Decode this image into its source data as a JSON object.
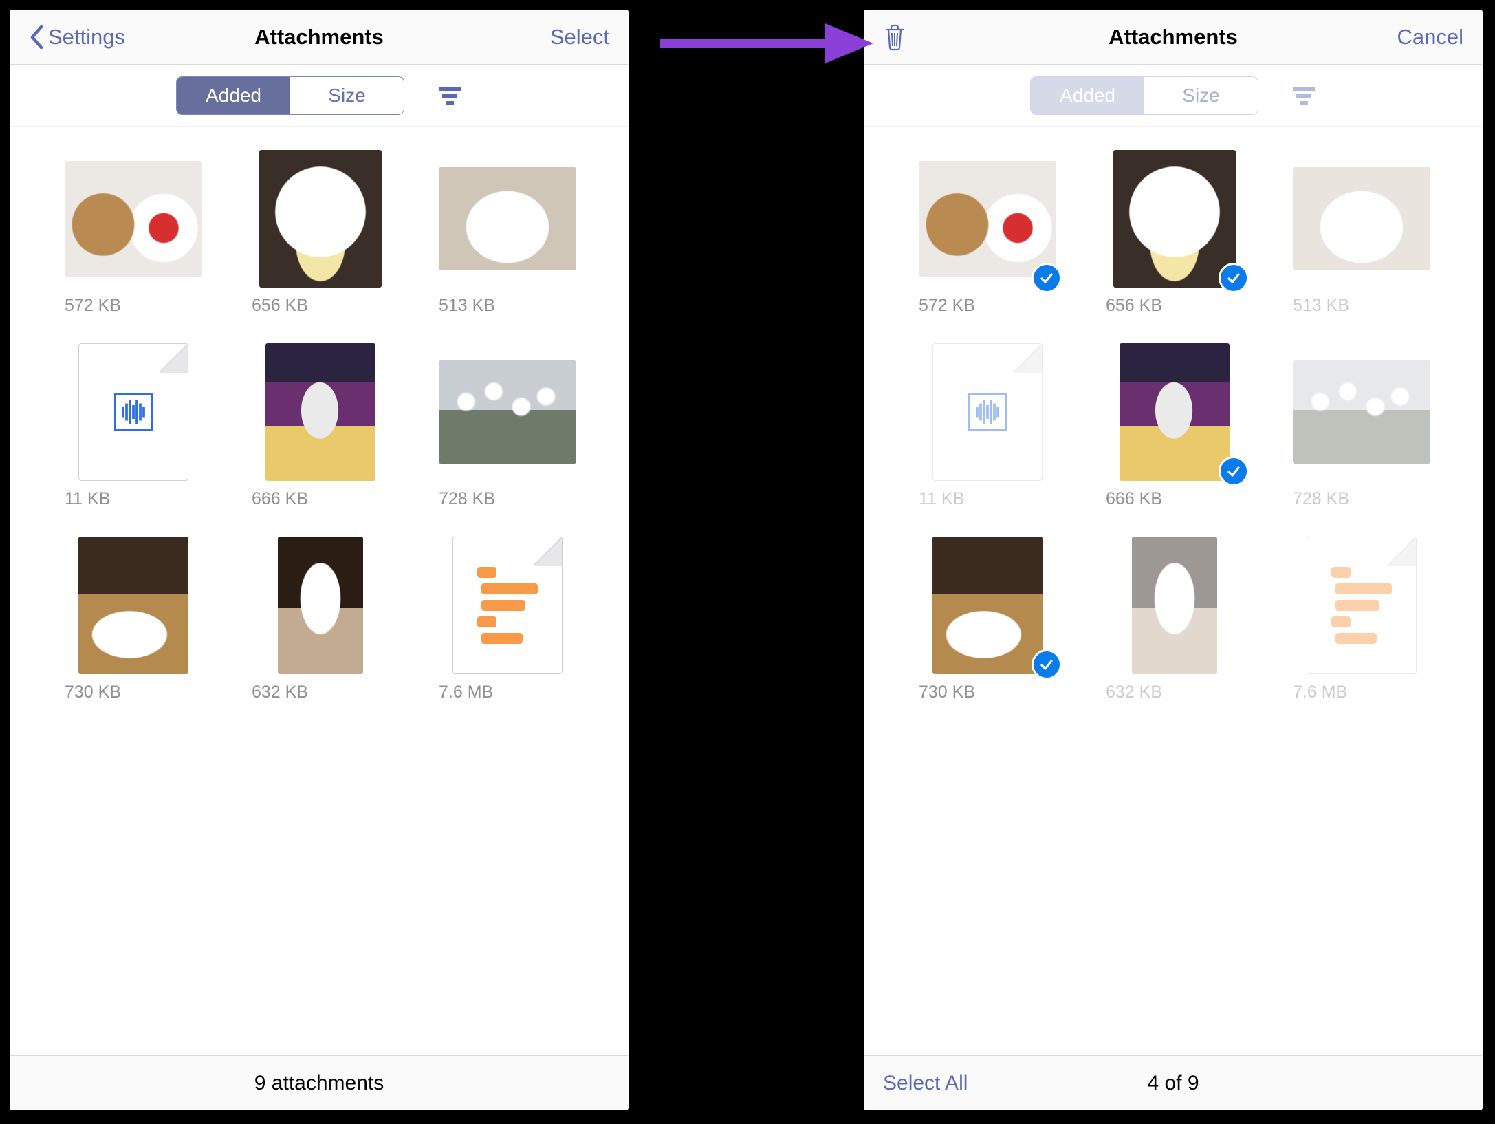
{
  "left": {
    "nav": {
      "back_label": "Settings",
      "title": "Attachments",
      "action_label": "Select"
    },
    "segments": {
      "added": "Added",
      "size": "Size"
    },
    "items": [
      {
        "size": "572 KB",
        "kind": "img",
        "cls": "t1"
      },
      {
        "size": "656 KB",
        "kind": "img",
        "cls": "t2"
      },
      {
        "size": "513 KB",
        "kind": "img",
        "cls": "t3"
      },
      {
        "size": "11 KB",
        "kind": "audio"
      },
      {
        "size": "666 KB",
        "kind": "img",
        "cls": "t5"
      },
      {
        "size": "728 KB",
        "kind": "img",
        "cls": "t6"
      },
      {
        "size": "730 KB",
        "kind": "img",
        "cls": "t7"
      },
      {
        "size": "632 KB",
        "kind": "img",
        "cls": "t8"
      },
      {
        "size": "7.6 MB",
        "kind": "doc"
      }
    ],
    "footer": "9 attachments"
  },
  "right": {
    "nav": {
      "title": "Attachments",
      "action_label": "Cancel"
    },
    "segments": {
      "added": "Added",
      "size": "Size"
    },
    "items": [
      {
        "size": "572 KB",
        "kind": "img",
        "cls": "t1",
        "selected": true
      },
      {
        "size": "656 KB",
        "kind": "img",
        "cls": "t2",
        "selected": true
      },
      {
        "size": "513 KB",
        "kind": "img",
        "cls": "t3",
        "selected": false,
        "faded": true
      },
      {
        "size": "11 KB",
        "kind": "audio",
        "selected": false,
        "faded": true
      },
      {
        "size": "666 KB",
        "kind": "img",
        "cls": "t5",
        "selected": true
      },
      {
        "size": "728 KB",
        "kind": "img",
        "cls": "t6",
        "selected": false,
        "faded": true
      },
      {
        "size": "730 KB",
        "kind": "img",
        "cls": "t7",
        "selected": true
      },
      {
        "size": "632 KB",
        "kind": "img",
        "cls": "t8",
        "selected": false,
        "faded": true
      },
      {
        "size": "7.6 MB",
        "kind": "doc",
        "selected": false,
        "faded": true
      }
    ],
    "footer_left": "Select All",
    "footer_center": "4 of 9"
  },
  "colors": {
    "accent": "#5969b3",
    "select": "#0a7bea",
    "arrow": "#8a3fd6"
  }
}
